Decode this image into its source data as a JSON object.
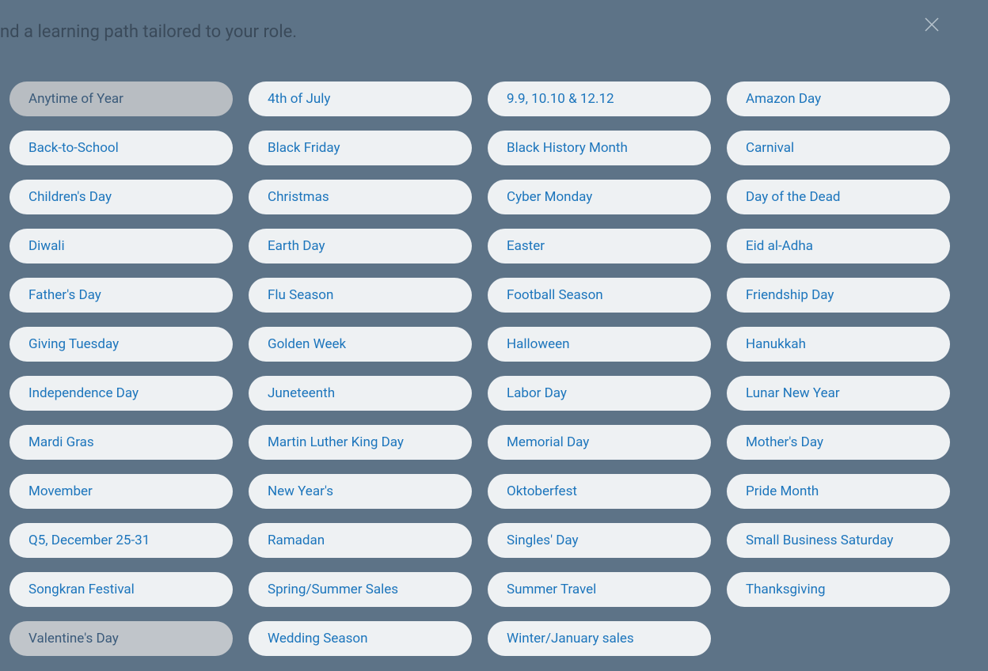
{
  "header_text": "nd a learning path tailored to your role.",
  "pills": [
    {
      "label": "Anytime of Year",
      "state": "selected"
    },
    {
      "label": "4th of July",
      "state": "default"
    },
    {
      "label": "9.9, 10.10 & 12.12",
      "state": "default"
    },
    {
      "label": "Amazon Day",
      "state": "default"
    },
    {
      "label": "Back-to-School",
      "state": "default"
    },
    {
      "label": "Black Friday",
      "state": "default"
    },
    {
      "label": "Black History Month",
      "state": "default"
    },
    {
      "label": "Carnival",
      "state": "default"
    },
    {
      "label": "Children's Day",
      "state": "default"
    },
    {
      "label": "Christmas",
      "state": "default"
    },
    {
      "label": "Cyber Monday",
      "state": "default"
    },
    {
      "label": "Day of the Dead",
      "state": "default"
    },
    {
      "label": "Diwali",
      "state": "default"
    },
    {
      "label": "Earth Day",
      "state": "default"
    },
    {
      "label": "Easter",
      "state": "default"
    },
    {
      "label": "Eid al-Adha",
      "state": "default"
    },
    {
      "label": "Father's Day",
      "state": "default"
    },
    {
      "label": "Flu Season",
      "state": "default"
    },
    {
      "label": "Football Season",
      "state": "default"
    },
    {
      "label": "Friendship Day",
      "state": "default"
    },
    {
      "label": "Giving Tuesday",
      "state": "default"
    },
    {
      "label": "Golden Week",
      "state": "default"
    },
    {
      "label": "Halloween",
      "state": "default"
    },
    {
      "label": "Hanukkah",
      "state": "default"
    },
    {
      "label": "Independence Day",
      "state": "default"
    },
    {
      "label": "Juneteenth",
      "state": "default"
    },
    {
      "label": "Labor Day",
      "state": "default"
    },
    {
      "label": "Lunar New Year",
      "state": "default"
    },
    {
      "label": "Mardi Gras",
      "state": "default"
    },
    {
      "label": "Martin Luther King Day",
      "state": "default"
    },
    {
      "label": "Memorial Day",
      "state": "default"
    },
    {
      "label": "Mother's Day",
      "state": "default"
    },
    {
      "label": "Movember",
      "state": "default"
    },
    {
      "label": "New Year's",
      "state": "default"
    },
    {
      "label": "Oktoberfest",
      "state": "default"
    },
    {
      "label": "Pride Month",
      "state": "default"
    },
    {
      "label": "Q5, December 25-31",
      "state": "default"
    },
    {
      "label": "Ramadan",
      "state": "default"
    },
    {
      "label": "Singles' Day",
      "state": "default"
    },
    {
      "label": "Small Business Saturday",
      "state": "default"
    },
    {
      "label": "Songkran Festival",
      "state": "default"
    },
    {
      "label": "Spring/Summer Sales",
      "state": "default"
    },
    {
      "label": "Summer Travel",
      "state": "default"
    },
    {
      "label": "Thanksgiving",
      "state": "default"
    },
    {
      "label": "Valentine's Day",
      "state": "hovered"
    },
    {
      "label": "Wedding Season",
      "state": "default"
    },
    {
      "label": "Winter/January sales",
      "state": "default"
    }
  ]
}
